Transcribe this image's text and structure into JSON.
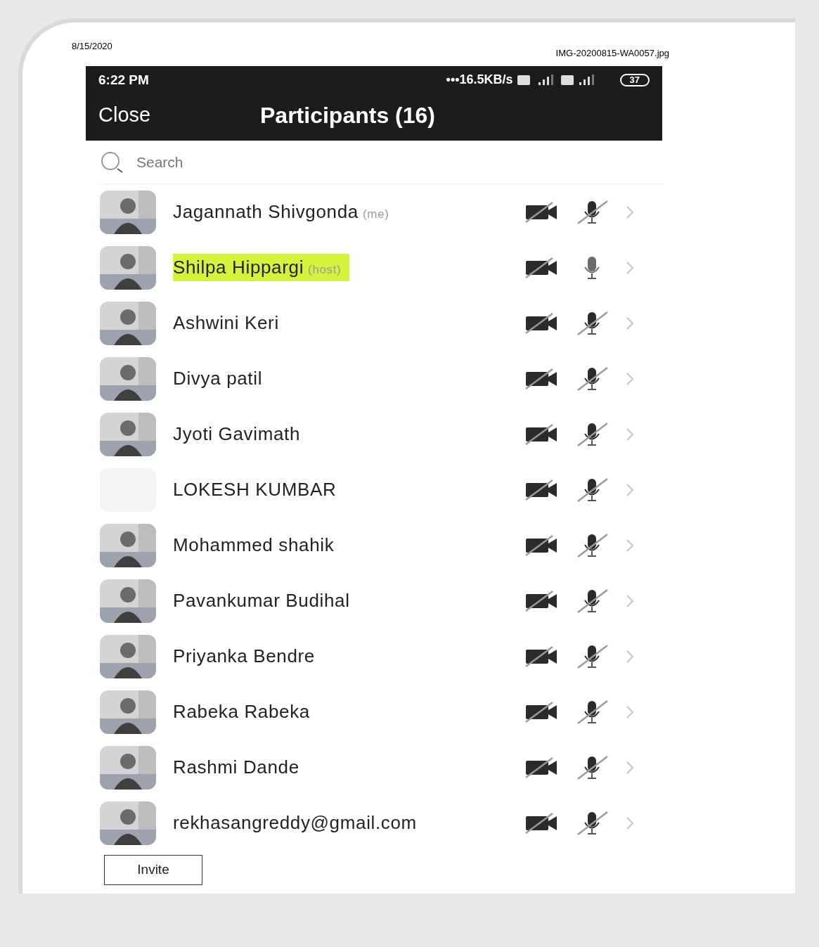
{
  "print_header": {
    "date": "8/15/2020",
    "filename": "IMG-20200815-WA0057.jpg"
  },
  "status_bar": {
    "time": "6:22 PM",
    "network_speed": "•••16.5KB/s",
    "battery": "37"
  },
  "nav": {
    "close": "Close",
    "title": "Participants (16)"
  },
  "search": {
    "placeholder": "Search"
  },
  "participants": [
    {
      "name": "Jagannath Shivgonda",
      "tag": "(me)",
      "highlighted": false,
      "muted": true,
      "has_photo": true
    },
    {
      "name": "Shilpa Hippargi",
      "tag": "(host)",
      "highlighted": true,
      "muted": false,
      "has_photo": true
    },
    {
      "name": "Ashwini Keri",
      "highlighted": false,
      "muted": true,
      "has_photo": true
    },
    {
      "name": "Divya patil",
      "highlighted": false,
      "muted": true,
      "has_photo": true
    },
    {
      "name": "Jyoti Gavimath",
      "highlighted": false,
      "muted": true,
      "has_photo": true
    },
    {
      "name": "LOKESH KUMBAR",
      "highlighted": false,
      "muted": true,
      "has_photo": false
    },
    {
      "name": "Mohammed shahik",
      "highlighted": false,
      "muted": true,
      "has_photo": true
    },
    {
      "name": "Pavankumar Budihal",
      "highlighted": false,
      "muted": true,
      "has_photo": true
    },
    {
      "name": "Priyanka Bendre",
      "highlighted": false,
      "muted": true,
      "has_photo": true
    },
    {
      "name": "Rabeka Rabeka",
      "highlighted": false,
      "muted": true,
      "has_photo": true
    },
    {
      "name": "Rashmi Dande",
      "highlighted": false,
      "muted": true,
      "has_photo": true
    },
    {
      "name": "rekhasangreddy@gmail.com",
      "highlighted": false,
      "muted": true,
      "has_photo": true
    }
  ],
  "invite_button": "Invite"
}
